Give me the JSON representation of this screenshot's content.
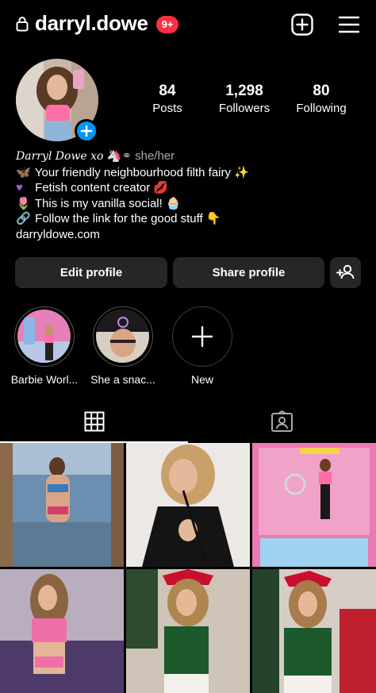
{
  "header": {
    "username": "darryl.dowe",
    "notifications_badge": "9+",
    "icons": [
      "lock-icon",
      "new-post-icon",
      "menu-icon"
    ]
  },
  "profile": {
    "stats": [
      {
        "value": "84",
        "label": "Posts"
      },
      {
        "value": "1,298",
        "label": "Followers"
      },
      {
        "value": "80",
        "label": "Following"
      }
    ]
  },
  "bio": {
    "name": "Darryl Dowe xo",
    "pronouns": "she/her",
    "lines": [
      "Your friendly neighbourhood filth fairy",
      "Fetish content creator",
      "This is my vanilla social!",
      "Follow the link for the good stuff"
    ],
    "link": "darryldowe.com"
  },
  "actions": {
    "edit_label": "Edit profile",
    "share_label": "Share profile"
  },
  "highlights": [
    {
      "label": "Barbie Worl..."
    },
    {
      "label": "She a snac..."
    },
    {
      "label": "New"
    }
  ],
  "colors": {
    "background": "#000000",
    "button": "#262626",
    "badge": "#ff3040",
    "accent": "#0095f6"
  }
}
